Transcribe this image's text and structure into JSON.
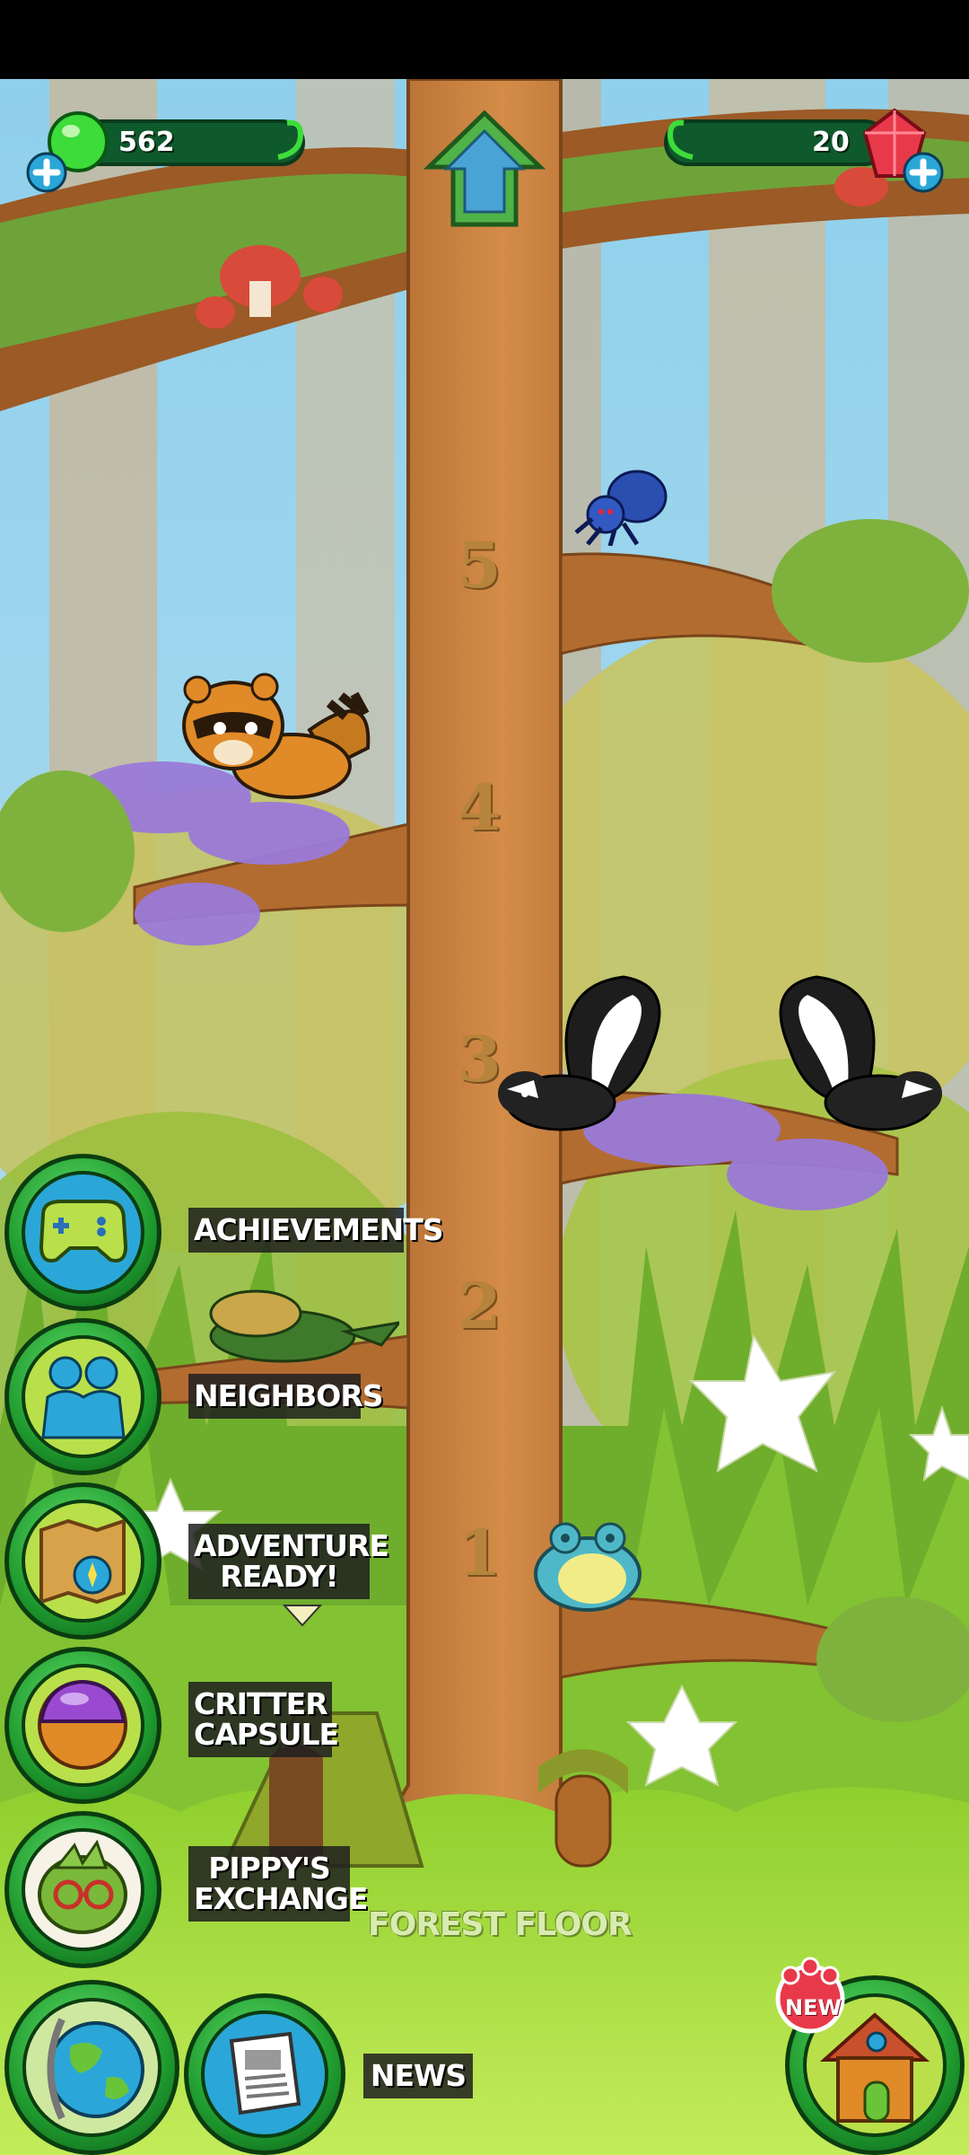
{
  "hud": {
    "leaf_count": "562",
    "gem_count": "20"
  },
  "tree": {
    "levels": [
      "5",
      "4",
      "3",
      "2",
      "1"
    ],
    "floor_label": "FOREST FLOOR"
  },
  "menu": {
    "achievements": "ACHIEVEMENTS",
    "neighbors": "NEIGHBORS",
    "adventure": "ADVENTURE READY!",
    "critter_capsule": "CRITTER CAPSULE",
    "pippys_exchange": "PIPPY'S EXCHANGE",
    "news": "NEWS"
  },
  "badges": {
    "new": "NEW"
  },
  "colors": {
    "sky": "#8fd0ec",
    "trunk": "#c8803f",
    "grass": "#9fd63a",
    "button_green": "#1f9a2e",
    "leaf_currency": "#3ddc3a",
    "gem_currency": "#e8394a"
  }
}
